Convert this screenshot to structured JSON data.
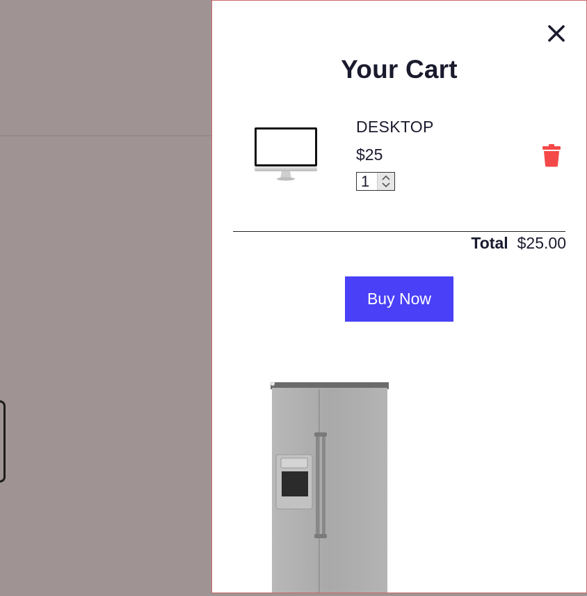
{
  "cart": {
    "title": "Your Cart",
    "close_icon": "close-icon",
    "items": [
      {
        "name": "DESKTOP",
        "price": "$25",
        "quantity": "1",
        "thumbnail_icon": "desktop-monitor-icon",
        "delete_icon": "trash-icon"
      }
    ],
    "total_label": "Total",
    "total_value": "$25.00",
    "buy_label": "Buy Now",
    "suggestion_image": "refrigerator-image"
  },
  "colors": {
    "backdrop": "#a09393",
    "drawer_bg": "#ffffff",
    "accent_button": "#4a40f7",
    "delete_red": "#f54848",
    "text": "#1a1a2e"
  }
}
